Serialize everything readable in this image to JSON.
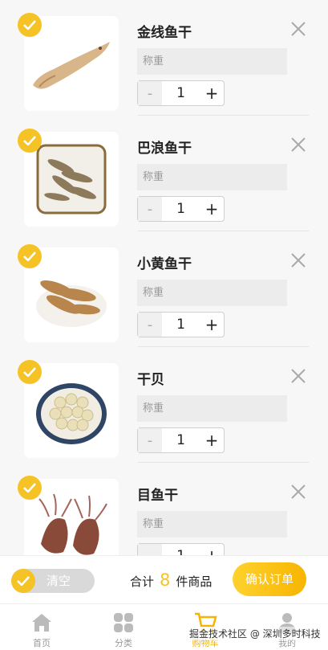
{
  "cart": {
    "items": [
      {
        "name": "金线鱼干",
        "weight_placeholder": "称重",
        "quantity": "1",
        "minus": "-",
        "plus": "+",
        "image_icon": "dried-fish-photo"
      },
      {
        "name": "巴浪鱼干",
        "weight_placeholder": "称重",
        "quantity": "1",
        "minus": "-",
        "plus": "+",
        "image_icon": "dried-fish-photo"
      },
      {
        "name": "小黄鱼干",
        "weight_placeholder": "称重",
        "quantity": "1",
        "minus": "-",
        "plus": "+",
        "image_icon": "dried-fish-photo"
      },
      {
        "name": "干贝",
        "weight_placeholder": "称重",
        "quantity": "1",
        "minus": "-",
        "plus": "+",
        "image_icon": "scallop-photo"
      },
      {
        "name": "目鱼干",
        "weight_placeholder": "称重",
        "quantity": "1",
        "minus": "-",
        "plus": "+",
        "image_icon": "dried-squid-photo"
      }
    ]
  },
  "footer": {
    "clear_label": "清空",
    "total_prefix": "合计",
    "total_count": "8",
    "total_suffix": "件商品",
    "confirm_label": "确认订单"
  },
  "tabs": [
    {
      "label": "首页",
      "icon": "home-icon"
    },
    {
      "label": "分类",
      "icon": "category-icon"
    },
    {
      "label": "购物车",
      "icon": "cart-icon"
    },
    {
      "label": "我的",
      "icon": "user-icon"
    }
  ],
  "watermark": "掘金技术社区 @ 深圳多时科技",
  "colors": {
    "accent": "#f5c326",
    "active_tab": "#f5b400"
  }
}
